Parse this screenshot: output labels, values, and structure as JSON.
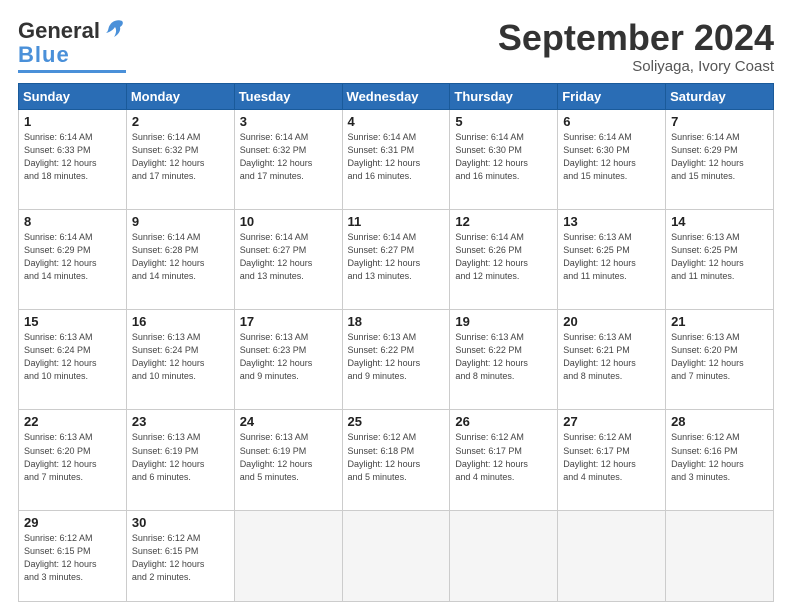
{
  "header": {
    "logo": {
      "general": "General",
      "blue": "Blue"
    },
    "title": "September 2024",
    "location": "Soliyaga, Ivory Coast"
  },
  "weekdays": [
    "Sunday",
    "Monday",
    "Tuesday",
    "Wednesday",
    "Thursday",
    "Friday",
    "Saturday"
  ],
  "weeks": [
    [
      {
        "day": "1",
        "info": "Sunrise: 6:14 AM\nSunset: 6:33 PM\nDaylight: 12 hours\nand 18 minutes."
      },
      {
        "day": "2",
        "info": "Sunrise: 6:14 AM\nSunset: 6:32 PM\nDaylight: 12 hours\nand 17 minutes."
      },
      {
        "day": "3",
        "info": "Sunrise: 6:14 AM\nSunset: 6:32 PM\nDaylight: 12 hours\nand 17 minutes."
      },
      {
        "day": "4",
        "info": "Sunrise: 6:14 AM\nSunset: 6:31 PM\nDaylight: 12 hours\nand 16 minutes."
      },
      {
        "day": "5",
        "info": "Sunrise: 6:14 AM\nSunset: 6:30 PM\nDaylight: 12 hours\nand 16 minutes."
      },
      {
        "day": "6",
        "info": "Sunrise: 6:14 AM\nSunset: 6:30 PM\nDaylight: 12 hours\nand 15 minutes."
      },
      {
        "day": "7",
        "info": "Sunrise: 6:14 AM\nSunset: 6:29 PM\nDaylight: 12 hours\nand 15 minutes."
      }
    ],
    [
      {
        "day": "8",
        "info": "Sunrise: 6:14 AM\nSunset: 6:29 PM\nDaylight: 12 hours\nand 14 minutes."
      },
      {
        "day": "9",
        "info": "Sunrise: 6:14 AM\nSunset: 6:28 PM\nDaylight: 12 hours\nand 14 minutes."
      },
      {
        "day": "10",
        "info": "Sunrise: 6:14 AM\nSunset: 6:27 PM\nDaylight: 12 hours\nand 13 minutes."
      },
      {
        "day": "11",
        "info": "Sunrise: 6:14 AM\nSunset: 6:27 PM\nDaylight: 12 hours\nand 13 minutes."
      },
      {
        "day": "12",
        "info": "Sunrise: 6:14 AM\nSunset: 6:26 PM\nDaylight: 12 hours\nand 12 minutes."
      },
      {
        "day": "13",
        "info": "Sunrise: 6:13 AM\nSunset: 6:25 PM\nDaylight: 12 hours\nand 11 minutes."
      },
      {
        "day": "14",
        "info": "Sunrise: 6:13 AM\nSunset: 6:25 PM\nDaylight: 12 hours\nand 11 minutes."
      }
    ],
    [
      {
        "day": "15",
        "info": "Sunrise: 6:13 AM\nSunset: 6:24 PM\nDaylight: 12 hours\nand 10 minutes."
      },
      {
        "day": "16",
        "info": "Sunrise: 6:13 AM\nSunset: 6:24 PM\nDaylight: 12 hours\nand 10 minutes."
      },
      {
        "day": "17",
        "info": "Sunrise: 6:13 AM\nSunset: 6:23 PM\nDaylight: 12 hours\nand 9 minutes."
      },
      {
        "day": "18",
        "info": "Sunrise: 6:13 AM\nSunset: 6:22 PM\nDaylight: 12 hours\nand 9 minutes."
      },
      {
        "day": "19",
        "info": "Sunrise: 6:13 AM\nSunset: 6:22 PM\nDaylight: 12 hours\nand 8 minutes."
      },
      {
        "day": "20",
        "info": "Sunrise: 6:13 AM\nSunset: 6:21 PM\nDaylight: 12 hours\nand 8 minutes."
      },
      {
        "day": "21",
        "info": "Sunrise: 6:13 AM\nSunset: 6:20 PM\nDaylight: 12 hours\nand 7 minutes."
      }
    ],
    [
      {
        "day": "22",
        "info": "Sunrise: 6:13 AM\nSunset: 6:20 PM\nDaylight: 12 hours\nand 7 minutes."
      },
      {
        "day": "23",
        "info": "Sunrise: 6:13 AM\nSunset: 6:19 PM\nDaylight: 12 hours\nand 6 minutes."
      },
      {
        "day": "24",
        "info": "Sunrise: 6:13 AM\nSunset: 6:19 PM\nDaylight: 12 hours\nand 5 minutes."
      },
      {
        "day": "25",
        "info": "Sunrise: 6:12 AM\nSunset: 6:18 PM\nDaylight: 12 hours\nand 5 minutes."
      },
      {
        "day": "26",
        "info": "Sunrise: 6:12 AM\nSunset: 6:17 PM\nDaylight: 12 hours\nand 4 minutes."
      },
      {
        "day": "27",
        "info": "Sunrise: 6:12 AM\nSunset: 6:17 PM\nDaylight: 12 hours\nand 4 minutes."
      },
      {
        "day": "28",
        "info": "Sunrise: 6:12 AM\nSunset: 6:16 PM\nDaylight: 12 hours\nand 3 minutes."
      }
    ],
    [
      {
        "day": "29",
        "info": "Sunrise: 6:12 AM\nSunset: 6:15 PM\nDaylight: 12 hours\nand 3 minutes."
      },
      {
        "day": "30",
        "info": "Sunrise: 6:12 AM\nSunset: 6:15 PM\nDaylight: 12 hours\nand 2 minutes."
      },
      {
        "day": "",
        "info": ""
      },
      {
        "day": "",
        "info": ""
      },
      {
        "day": "",
        "info": ""
      },
      {
        "day": "",
        "info": ""
      },
      {
        "day": "",
        "info": ""
      }
    ]
  ]
}
